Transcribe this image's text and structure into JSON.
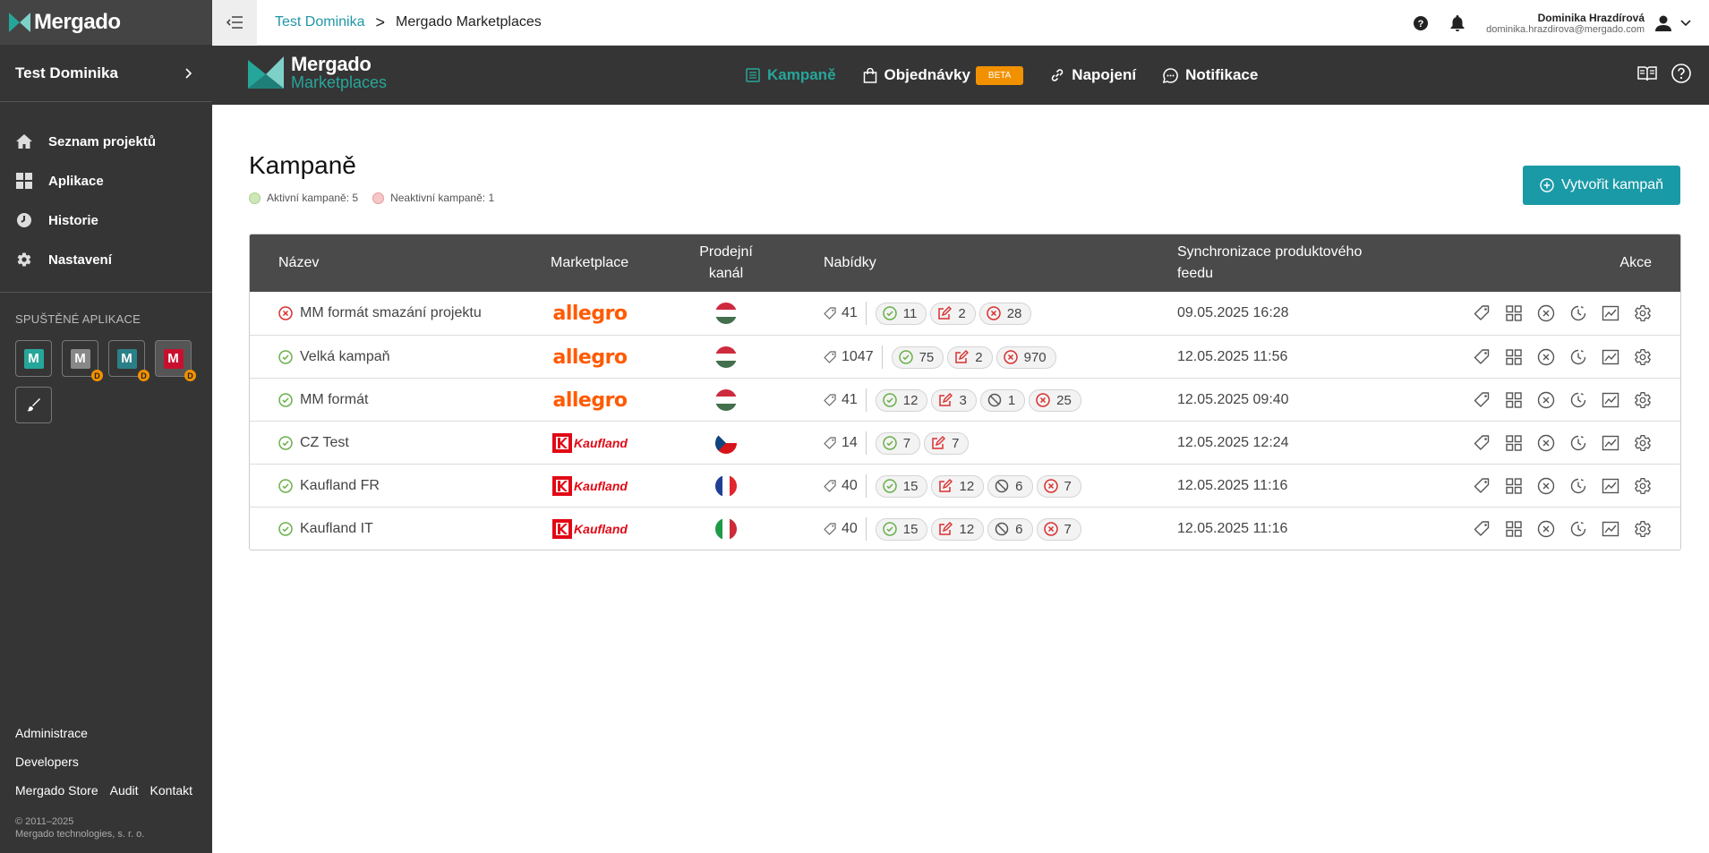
{
  "sidebar": {
    "brand": "Mergado",
    "project": "Test Dominika",
    "nav": [
      {
        "label": "Seznam projektů",
        "icon": "home-icon"
      },
      {
        "label": "Aplikace",
        "icon": "grid-icon"
      },
      {
        "label": "Historie",
        "icon": "history-icon"
      },
      {
        "label": "Nastavení",
        "icon": "gear-icon"
      }
    ],
    "running_apps_title": "SPUŠTĚNÉ APLIKACE",
    "apps": [
      {
        "letter": "M",
        "color": "#26a69a",
        "badge": ""
      },
      {
        "letter": "M",
        "color": "#888888",
        "badge": "D"
      },
      {
        "letter": "M",
        "color": "#2b7f86",
        "badge": "D"
      },
      {
        "letter": "M",
        "color": "#c8102e",
        "badge": "D"
      }
    ],
    "footer": {
      "administrace": "Administrace",
      "developers": "Developers",
      "store": "Mergado Store",
      "audit": "Audit",
      "kontakt": "Kontakt",
      "copyright_line1": "© 2011–2025",
      "copyright_line2": "Mergado technologies, s. r. o."
    }
  },
  "topbar": {
    "breadcrumb_project": "Test Dominika",
    "breadcrumb_sep": ">",
    "breadcrumb_app": "Mergado Marketplaces",
    "user_name": "Dominika Hrazdírová",
    "user_email": "dominika.hrazdirova@mergado.com"
  },
  "app_header": {
    "logo_line1": "Mergado",
    "logo_line2": "Marketplaces",
    "tabs": [
      {
        "label": "Kampaně",
        "icon": "list-icon",
        "active": true
      },
      {
        "label": "Objednávky",
        "icon": "bag-icon",
        "badge": "BETA"
      },
      {
        "label": "Napojení",
        "icon": "link-icon"
      },
      {
        "label": "Notifikace",
        "icon": "chat-icon"
      }
    ]
  },
  "page": {
    "title": "Kampaně",
    "active_label": "Aktivní kampaně: 5",
    "inactive_label": "Neaktivní kampaně: 1",
    "create_button": "Vytvořit kampaň",
    "colors": {
      "active": "#b9dc9a",
      "inactive": "#f2a9a9",
      "accent": "#1a9aa6"
    }
  },
  "table": {
    "headers": {
      "name": "Název",
      "marketplace": "Marketplace",
      "channel_line1": "Prodejní",
      "channel_line2": "kanál",
      "offers": "Nabídky",
      "sync_line1": "Synchronizace produktového",
      "sync_line2": "feedu",
      "actions": "Akce"
    },
    "rows": [
      {
        "status": "error",
        "name": "MM formát smazání projektu",
        "marketplace": "allegro",
        "flag": "hu",
        "total": "41",
        "pills": [
          {
            "type": "ok",
            "value": "11"
          },
          {
            "type": "edit",
            "value": "2"
          },
          {
            "type": "error",
            "value": "28"
          }
        ],
        "sync": "09.05.2025 16:28"
      },
      {
        "status": "ok",
        "name": "Velká kampaň",
        "marketplace": "allegro",
        "flag": "hu",
        "total": "1047",
        "pills": [
          {
            "type": "ok",
            "value": "75"
          },
          {
            "type": "edit",
            "value": "2"
          },
          {
            "type": "error",
            "value": "970"
          }
        ],
        "sync": "12.05.2025 11:56"
      },
      {
        "status": "ok",
        "name": "MM formát",
        "marketplace": "allegro",
        "flag": "hu",
        "total": "41",
        "pills": [
          {
            "type": "ok",
            "value": "12"
          },
          {
            "type": "edit",
            "value": "3"
          },
          {
            "type": "blocked",
            "value": "1"
          },
          {
            "type": "error",
            "value": "25"
          }
        ],
        "sync": "12.05.2025 09:40"
      },
      {
        "status": "ok",
        "name": "CZ Test",
        "marketplace": "Kaufland",
        "flag": "cz",
        "total": "14",
        "pills": [
          {
            "type": "ok",
            "value": "7"
          },
          {
            "type": "edit",
            "value": "7"
          }
        ],
        "sync": "12.05.2025 12:24"
      },
      {
        "status": "ok",
        "name": "Kaufland FR",
        "marketplace": "Kaufland",
        "flag": "fr",
        "total": "40",
        "pills": [
          {
            "type": "ok",
            "value": "15"
          },
          {
            "type": "edit",
            "value": "12"
          },
          {
            "type": "blocked",
            "value": "6"
          },
          {
            "type": "error",
            "value": "7"
          }
        ],
        "sync": "12.05.2025 11:16"
      },
      {
        "status": "ok",
        "name": "Kaufland IT",
        "marketplace": "Kaufland",
        "flag": "it",
        "total": "40",
        "pills": [
          {
            "type": "ok",
            "value": "15"
          },
          {
            "type": "edit",
            "value": "12"
          },
          {
            "type": "blocked",
            "value": "6"
          },
          {
            "type": "error",
            "value": "7"
          }
        ],
        "sync": "12.05.2025 11:16"
      }
    ],
    "action_icons": [
      "tag-icon",
      "grid-icon",
      "cancel-icon",
      "history-icon",
      "chart-icon",
      "gear-icon"
    ]
  }
}
